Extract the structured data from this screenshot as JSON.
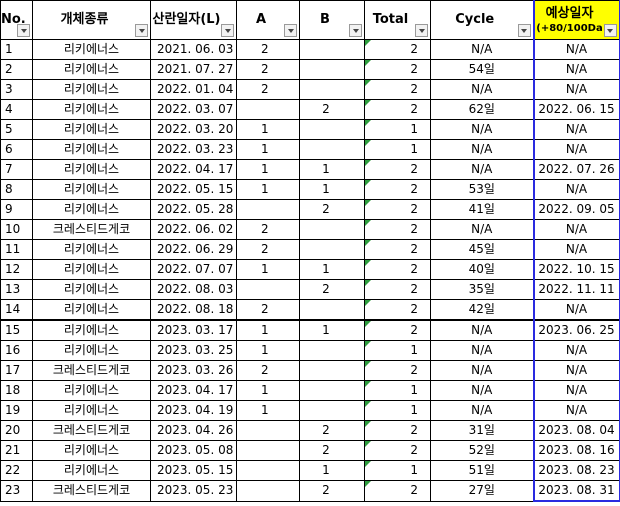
{
  "headers": {
    "no": "No.",
    "type": "개체종류",
    "date": "산란일자(L)",
    "a": "A",
    "b": "B",
    "total": "Total",
    "cycle": "Cycle",
    "expected": "예상일자",
    "expected_sub": "(+80/100Da"
  },
  "colors": {
    "expected_header_bg": "#ffff00",
    "expected_border": "#2a2ae0",
    "total_marker": "#2e9e3e"
  },
  "rows": [
    {
      "no": "1",
      "type": "리키에너스",
      "date": "2021. 06. 03",
      "a": "2",
      "b": "",
      "total": "2",
      "cycle": "N/A",
      "expected": "N/A"
    },
    {
      "no": "2",
      "type": "리키에너스",
      "date": "2021. 07. 27",
      "a": "2",
      "b": "",
      "total": "2",
      "cycle": "54일",
      "expected": "N/A"
    },
    {
      "no": "3",
      "type": "리키에너스",
      "date": "2022. 01. 04",
      "a": "2",
      "b": "",
      "total": "2",
      "cycle": "N/A",
      "expected": "N/A"
    },
    {
      "no": "4",
      "type": "리키에너스",
      "date": "2022. 03. 07",
      "a": "",
      "b": "2",
      "total": "2",
      "cycle": "62일",
      "expected": "2022. 06. 15"
    },
    {
      "no": "5",
      "type": "리키에너스",
      "date": "2022. 03. 20",
      "a": "1",
      "b": "",
      "total": "1",
      "cycle": "N/A",
      "expected": "N/A"
    },
    {
      "no": "6",
      "type": "리키에너스",
      "date": "2022. 03. 23",
      "a": "1",
      "b": "",
      "total": "1",
      "cycle": "N/A",
      "expected": "N/A"
    },
    {
      "no": "7",
      "type": "리키에너스",
      "date": "2022. 04. 17",
      "a": "1",
      "b": "1",
      "total": "2",
      "cycle": "N/A",
      "expected": "2022. 07. 26"
    },
    {
      "no": "8",
      "type": "리키에너스",
      "date": "2022. 05. 15",
      "a": "1",
      "b": "1",
      "total": "2",
      "cycle": "53일",
      "expected": "N/A"
    },
    {
      "no": "9",
      "type": "리키에너스",
      "date": "2022. 05. 28",
      "a": "",
      "b": "2",
      "total": "2",
      "cycle": "41일",
      "expected": "2022. 09. 05"
    },
    {
      "no": "10",
      "type": "크레스티드게코",
      "date": "2022. 06. 02",
      "a": "2",
      "b": "",
      "total": "2",
      "cycle": "N/A",
      "expected": "N/A"
    },
    {
      "no": "11",
      "type": "리키에너스",
      "date": "2022. 06. 29",
      "a": "2",
      "b": "",
      "total": "2",
      "cycle": "45일",
      "expected": "N/A"
    },
    {
      "no": "12",
      "type": "리키에너스",
      "date": "2022. 07. 07",
      "a": "1",
      "b": "1",
      "total": "2",
      "cycle": "40일",
      "expected": "2022. 10. 15"
    },
    {
      "no": "13",
      "type": "리키에너스",
      "date": "2022. 08. 03",
      "a": "",
      "b": "2",
      "total": "2",
      "cycle": "35일",
      "expected": "2022. 11. 11"
    },
    {
      "no": "14",
      "type": "리키에너스",
      "date": "2022. 08. 18",
      "a": "2",
      "b": "",
      "total": "2",
      "cycle": "42일",
      "expected": "N/A"
    },
    {
      "no": "15",
      "type": "리키에너스",
      "date": "2023. 03. 17",
      "a": "1",
      "b": "1",
      "total": "2",
      "cycle": "N/A",
      "expected": "2023. 06. 25"
    },
    {
      "no": "16",
      "type": "리키에너스",
      "date": "2023. 03. 25",
      "a": "1",
      "b": "",
      "total": "1",
      "cycle": "N/A",
      "expected": "N/A"
    },
    {
      "no": "17",
      "type": "크레스티드게코",
      "date": "2023. 03. 26",
      "a": "2",
      "b": "",
      "total": "2",
      "cycle": "N/A",
      "expected": "N/A"
    },
    {
      "no": "18",
      "type": "리키에너스",
      "date": "2023. 04. 17",
      "a": "1",
      "b": "",
      "total": "1",
      "cycle": "N/A",
      "expected": "N/A"
    },
    {
      "no": "19",
      "type": "리키에너스",
      "date": "2023. 04. 19",
      "a": "1",
      "b": "",
      "total": "1",
      "cycle": "N/A",
      "expected": "N/A"
    },
    {
      "no": "20",
      "type": "크레스티드게코",
      "date": "2023. 04. 26",
      "a": "",
      "b": "2",
      "total": "2",
      "cycle": "31일",
      "expected": "2023. 08. 04"
    },
    {
      "no": "21",
      "type": "리키에너스",
      "date": "2023. 05. 08",
      "a": "",
      "b": "2",
      "total": "2",
      "cycle": "52일",
      "expected": "2023. 08. 16"
    },
    {
      "no": "22",
      "type": "리키에너스",
      "date": "2023. 05. 15",
      "a": "",
      "b": "1",
      "total": "1",
      "cycle": "51일",
      "expected": "2023. 08. 23"
    },
    {
      "no": "23",
      "type": "크레스티드게코",
      "date": "2023. 05. 23",
      "a": "",
      "b": "2",
      "total": "2",
      "cycle": "27일",
      "expected": "2023. 08. 31"
    }
  ]
}
